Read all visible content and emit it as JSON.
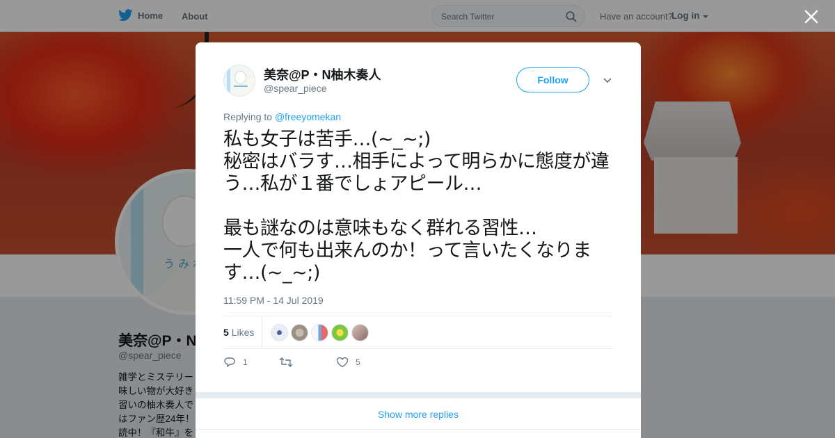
{
  "nav": {
    "home_label": "Home",
    "about_label": "About",
    "search_placeholder": "Search Twitter",
    "have_account": "Have an account?",
    "login_label": "Log in",
    "brand_color": "#1da1f2"
  },
  "profile": {
    "name": "美奈@P・N柚木奏人",
    "handle": "@spear_piece",
    "avatar_label": "うみね",
    "bio_lines": [
      "雑学とミステリー",
      "味しい物が大好き",
      "習いの柚木奏人で",
      "はファン歴24年！",
      "読中！『和牛』を"
    ]
  },
  "tweet": {
    "author_name": "美奈@P・N柚木奏人",
    "author_handle": "@spear_piece",
    "follow_label": "Follow",
    "replying_prefix": "Replying to",
    "replying_to": "@freeyomekan",
    "text": "私も女子は苦手…(~_~;)\n秘密はバラす…相手によって明らかに態度が違う…私が１番でしょアピール…\n\n最も謎なのは意味もなく群れる習性…\n一人で何も出来んのか！って言いたくなります…(~_~;)",
    "timestamp": "11:59 PM - 14 Jul 2019",
    "likes_count": "5",
    "likes_label": "Likes",
    "reply_count": "1",
    "retweet_count": "",
    "like_count": "5"
  },
  "likers": [
    {
      "icon": "liker-avatar-1",
      "color": "#e8eef3"
    },
    {
      "icon": "liker-avatar-2",
      "color": "#9c8f84"
    },
    {
      "icon": "liker-avatar-3",
      "color": "#d9e6f3"
    },
    {
      "icon": "liker-avatar-4",
      "color": "#7cc742"
    },
    {
      "icon": "liker-avatar-5",
      "color": "#b89a92"
    }
  ],
  "show_more_label": "Show more replies"
}
